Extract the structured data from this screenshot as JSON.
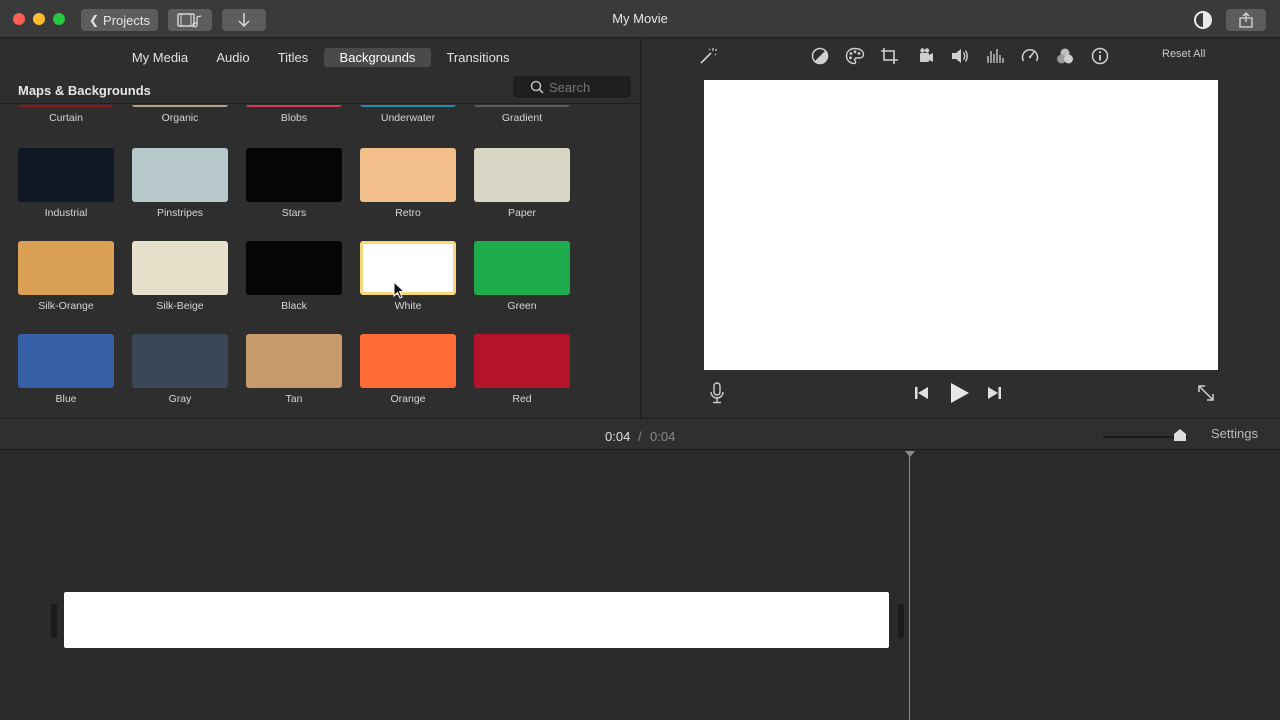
{
  "window": {
    "title": "My Movie"
  },
  "toolbar": {
    "projects_label": "Projects"
  },
  "tabs": [
    {
      "label": "My Media",
      "active": false
    },
    {
      "label": "Audio",
      "active": false
    },
    {
      "label": "Titles",
      "active": false
    },
    {
      "label": "Backgrounds",
      "active": true
    },
    {
      "label": "Transitions",
      "active": false
    }
  ],
  "section": {
    "title": "Maps & Backgrounds"
  },
  "search": {
    "placeholder": "Search"
  },
  "backgrounds": [
    {
      "label": "Curtain",
      "color": "#8a1a1a"
    },
    {
      "label": "Organic",
      "color": "#b9a48a"
    },
    {
      "label": "Blobs",
      "color": "#d43b55"
    },
    {
      "label": "Underwater",
      "color": "#1d8fa8"
    },
    {
      "label": "Gradient",
      "color": "#5c5c66"
    },
    {
      "label": "Industrial",
      "color": "#0f1824"
    },
    {
      "label": "Pinstripes",
      "color": "#b8c9cc"
    },
    {
      "label": "Stars",
      "color": "#050505"
    },
    {
      "label": "Retro",
      "color": "#f3bf8a"
    },
    {
      "label": "Paper",
      "color": "#d8d6c4"
    },
    {
      "label": "Silk-Orange",
      "color": "#d9a056"
    },
    {
      "label": "Silk-Beige",
      "color": "#e7e1cc"
    },
    {
      "label": "Black",
      "color": "#060606"
    },
    {
      "label": "White",
      "color": "#ffffff",
      "selected": true
    },
    {
      "label": "Green",
      "color": "#1fac4c"
    },
    {
      "label": "Blue",
      "color": "#3560a8"
    },
    {
      "label": "Gray",
      "color": "#3c4659"
    },
    {
      "label": "Tan",
      "color": "#c89c6a"
    },
    {
      "label": "Orange",
      "color": "#ff6a35"
    },
    {
      "label": "Red",
      "color": "#b5122b"
    }
  ],
  "viewer": {
    "reset_all_label": "Reset All",
    "tools": [
      "magic-wand",
      "color-balance",
      "color-correction",
      "crop",
      "stabilization",
      "volume",
      "noise-reduction",
      "speed",
      "clip-filter",
      "info"
    ]
  },
  "timeline": {
    "current_time": "0:04",
    "separator": "/",
    "total_time": "0:04",
    "settings_label": "Settings",
    "zoom_level": 0.9
  }
}
